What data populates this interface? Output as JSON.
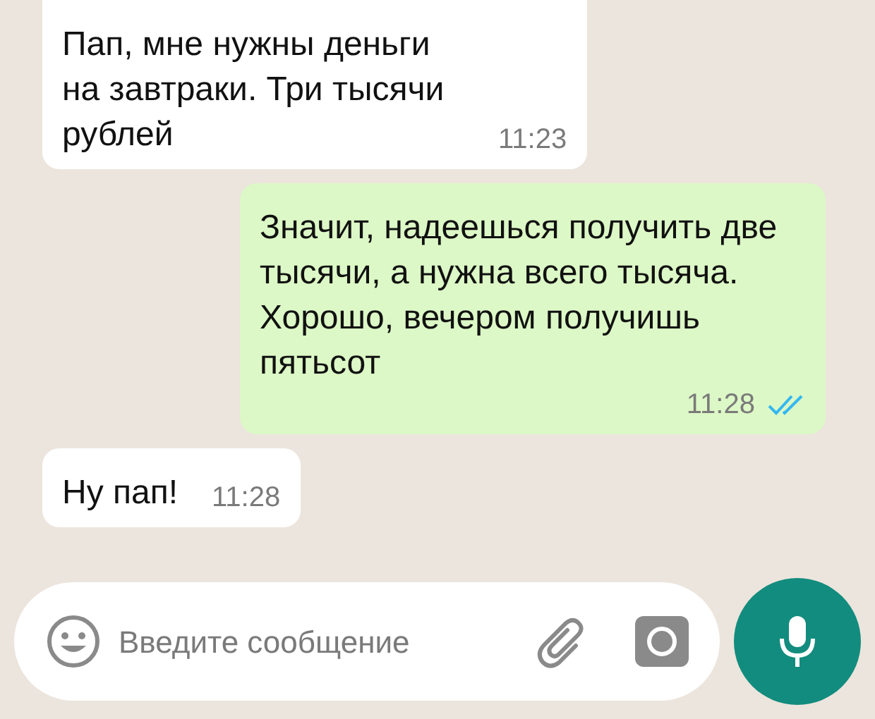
{
  "messages": [
    {
      "text": "Пап, мне нужны деньги на завтраки. Три тысячи рублей",
      "time": "11:23",
      "outgoing": false
    },
    {
      "text": "Значит, надеешься получить две тысячи, а нужна всего тысяча. Хорошо, вечером получишь пятьсот",
      "time": "11:28",
      "outgoing": true,
      "read": true
    },
    {
      "text": "Ну пап!",
      "time": "11:28",
      "outgoing": false
    }
  ],
  "composer": {
    "placeholder": "Введите сообщение"
  }
}
